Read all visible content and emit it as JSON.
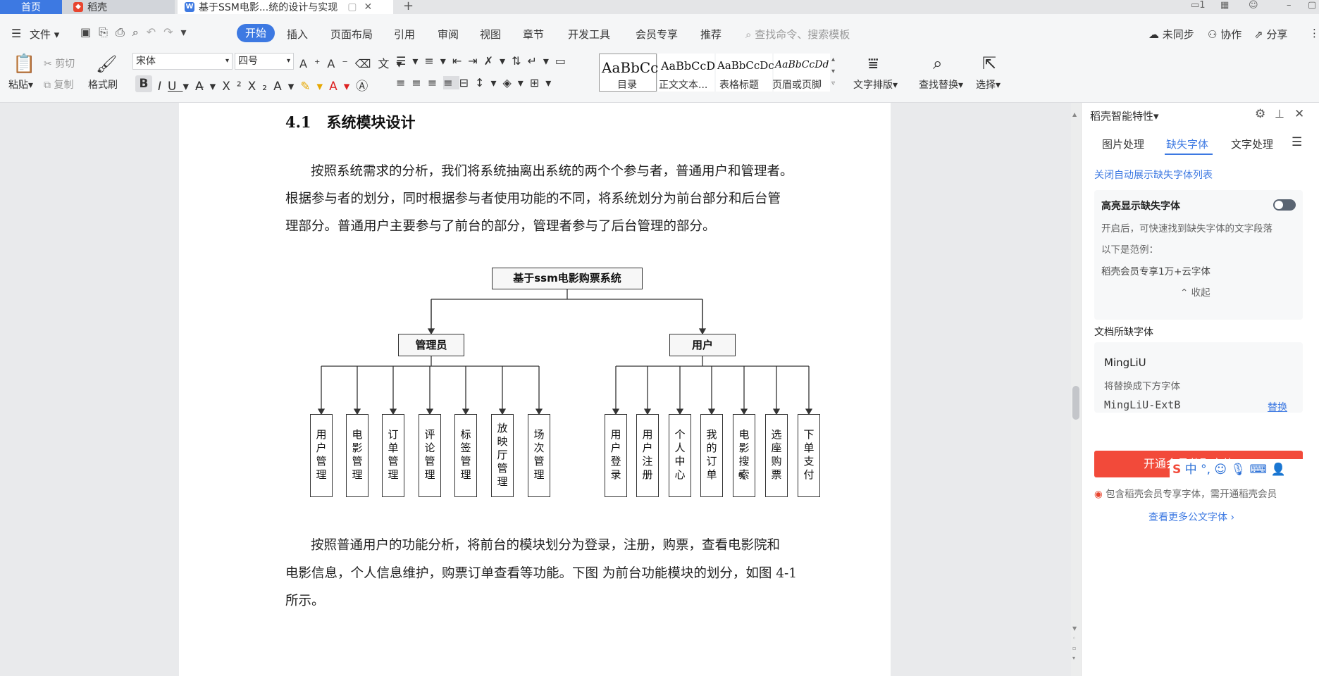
{
  "tabs": {
    "home": "首页",
    "daoke": "稻壳",
    "doc": "基于SSM电影...统的设计与实现"
  },
  "menu": {
    "file": "文件",
    "start": "开始",
    "items": [
      "插入",
      "页面布局",
      "引用",
      "审阅",
      "视图",
      "章节",
      "开发工具",
      "会员专享",
      "推荐"
    ],
    "search_placeholder": "查找命令、搜索模板",
    "unsynced": "未同步",
    "collab": "协作",
    "share": "分享"
  },
  "ribbon": {
    "paste": "粘贴",
    "cut": "剪切",
    "copy": "复制",
    "format_painter": "格式刷",
    "font_name": "宋体",
    "font_size": "四号",
    "styles": [
      {
        "sample": "AaBbCc",
        "label": "目录"
      },
      {
        "sample": "AaBbCcD",
        "label": "正文文本..."
      },
      {
        "sample": "AaBbCcDc",
        "label": "表格标题"
      },
      {
        "sample": "AaBbCcDd",
        "label": "页眉或页脚"
      }
    ],
    "text_layout": "文字排版",
    "find_replace": "查找替换",
    "select": "选择"
  },
  "document": {
    "heading_num": "4.1",
    "heading_text": "系统模块设计",
    "para1": [
      "按照系统需求的分析，我们将系统抽离出系统的两个个参与者，普通用户和管理者。",
      "根据参与者的划分，同时根据参与者使用功能的不同，将系统划分为前台部分和后台管",
      "理部分。普通用户主要参与了前台的部分，管理者参与了后台管理的部分。"
    ],
    "para2": [
      "按照普通用户的功能分析，将前台的模块划分为登录，注册，购票，查看电影院和",
      "电影信息，个人信息维护，购票订单查看等功能。下图 为前台功能模块的划分，如图 4-1",
      "所示。"
    ],
    "diagram": {
      "root": "基于ssm电影购票系统",
      "admin": "管理员",
      "user": "用户",
      "admin_modules": [
        "用户管理",
        "电影管理",
        "订单管理",
        "评论管理",
        "标签管理",
        "放映厅管理",
        "场次管理"
      ],
      "user_modules": [
        "用户登录",
        "用户注册",
        "个人中心",
        "我的订单",
        "电影搜索",
        "选座购票",
        "下单支付"
      ]
    }
  },
  "panel": {
    "title": "稻壳智能特性",
    "tabs": [
      "图片处理",
      "缺失字体",
      "文字处理"
    ],
    "close_auto": "关闭自动展示缺失字体列表",
    "highlight_title": "高亮显示缺失字体",
    "highlight_desc": "开启后，可快速找到缺失字体的文字段落",
    "example_label": "以下是范例：",
    "example_text": "稻壳会员专享1万+云字体",
    "collapse": "收起",
    "missing_title": "文档所缺字体",
    "missing_font": "MingLiU",
    "replace_hint": "将替换成下方字体",
    "replace_font": "MingLiU-ExtB",
    "replace_btn": "替换",
    "vip_btn": "开通会员获取字体",
    "vip_note": "包含稻壳会员专享字体，需开通稻壳会员",
    "more_fonts": "查看更多公文字体"
  },
  "ime": {
    "mode": "中"
  },
  "colors": {
    "accent": "#3d79e2",
    "vip": "#f24a3a"
  }
}
